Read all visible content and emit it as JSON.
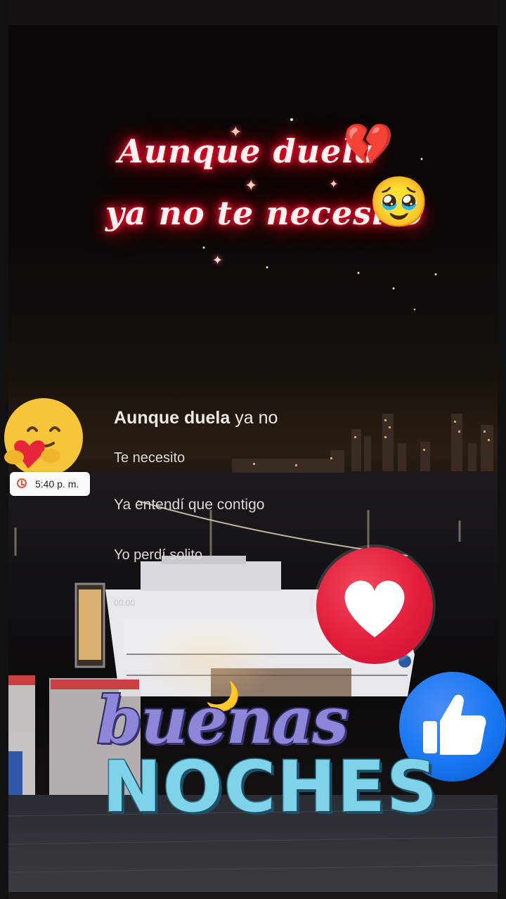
{
  "overlay_title": {
    "line1": "Aunque duela",
    "line2": "ya no te necesito",
    "emoji1": "💔",
    "emoji2": "🥹"
  },
  "lyrics": {
    "line1_bold": "Aunque duela",
    "line1_rest": " ya no",
    "line2": "Te necesito",
    "line3": "Ya entendí que contigo",
    "line4": "Yo perdí solito",
    "timer": "00:00"
  },
  "time_badge": {
    "text": "5:40 p. m."
  },
  "reactions": {
    "care_icon": "care-emoji-icon",
    "heart_icon": "heart-reaction-icon",
    "like_icon": "thumbs-up-icon"
  },
  "greeting": {
    "line1": "buenas",
    "line2": "NOCHES"
  },
  "colors": {
    "neon_red": "#ff1030",
    "heart_red": "#e21d3c",
    "like_blue": "#1877f2",
    "buenas_purple": "#8e86d8",
    "noches_cyan": "#7fd3e8"
  }
}
